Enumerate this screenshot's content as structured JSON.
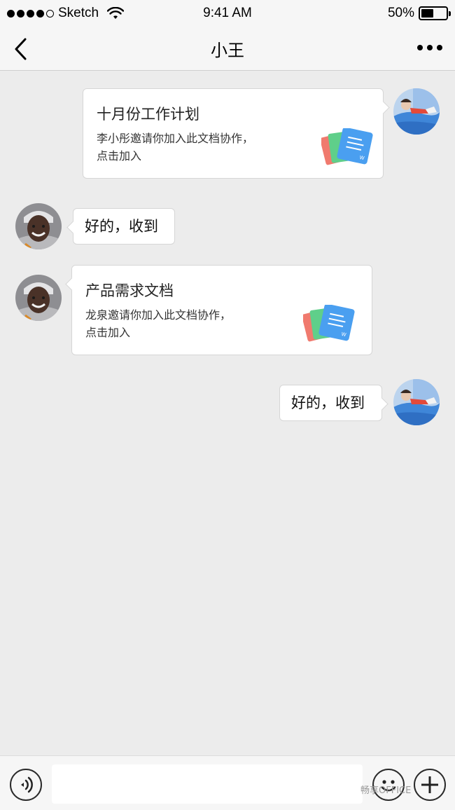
{
  "status_bar": {
    "carrier": "Sketch",
    "time": "9:41 AM",
    "battery_percent": "50%",
    "battery_level": 0.5
  },
  "nav": {
    "title": "小王",
    "back_icon": "chevron-left-icon",
    "more_icon": "more-dots-icon"
  },
  "messages": [
    {
      "side": "right",
      "type": "doc",
      "title": "十月份工作计划",
      "desc_line1": "李小彤邀请你加入此文档协作，",
      "desc_line2": "点击加入"
    },
    {
      "side": "left",
      "type": "text",
      "text": "好的，收到"
    },
    {
      "side": "left",
      "type": "doc",
      "title": "产品需求文档",
      "desc_line1": "龙泉邀请你加入此文档协作，",
      "desc_line2": "点击加入"
    },
    {
      "side": "right",
      "type": "text",
      "text": "好的，收到"
    }
  ],
  "input_bar": {
    "voice_icon": "voice-icon",
    "emoji_icon": "emoji-icon",
    "plus_icon": "plus-icon",
    "input_value": ""
  },
  "watermark": "畅享OFFICE",
  "colors": {
    "background": "#ececec",
    "bar": "#f6f6f6",
    "doc_blue": "#4a9ff0",
    "doc_green": "#5fcf8a",
    "doc_red": "#f07a6e"
  }
}
